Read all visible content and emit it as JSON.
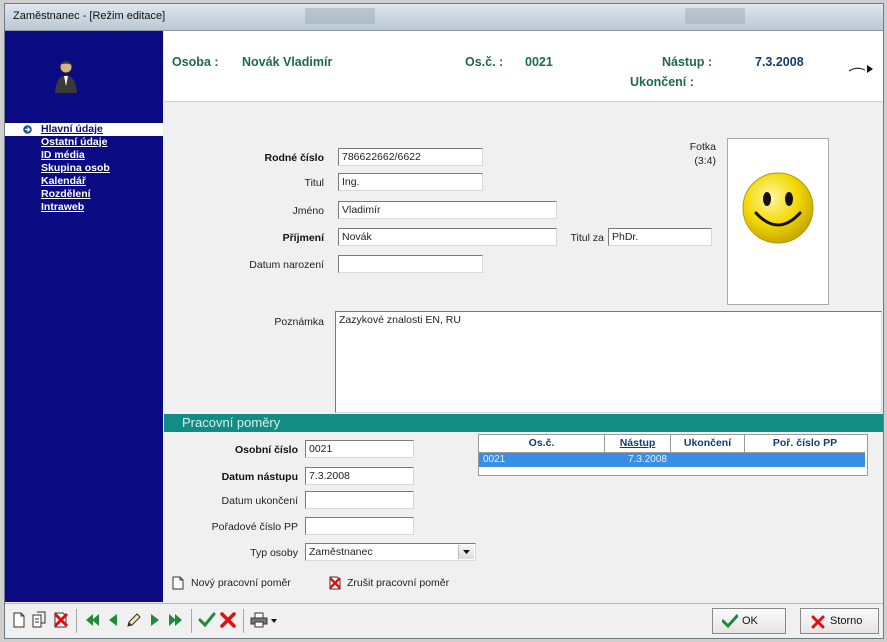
{
  "window": {
    "title": "Zaměstnanec - [Režim editace]"
  },
  "sidebar": {
    "items": [
      {
        "label": "Hlavní údaje",
        "active": true
      },
      {
        "label": "Ostatní údaje"
      },
      {
        "label": "ID média"
      },
      {
        "label": "Skupina osob"
      },
      {
        "label": "Kalendář"
      },
      {
        "label": "Rozdělení"
      },
      {
        "label": "Intraweb"
      }
    ]
  },
  "header": {
    "osoba_label": "Osoba :",
    "osoba_value": "Novák Vladimír",
    "osc_label": "Os.č. :",
    "osc_value": "0021",
    "nastup_label": "Nástup :",
    "nastup_value": "7.3.2008",
    "ukonceni_label": "Ukončení :"
  },
  "form": {
    "rodne_cislo_label": "Rodné číslo",
    "rodne_cislo_value": "786622662/6622",
    "titul_label": "Titul",
    "titul_value": "Ing.",
    "jmeno_label": "Jméno",
    "jmeno_value": "Vladimír",
    "prijmeni_label": "Příjmení",
    "prijmeni_value": "Novák",
    "titul_za_label": "Titul za",
    "titul_za_value": "PhDr.",
    "datum_narozeni_label": "Datum narození",
    "datum_narozeni_value": "",
    "fotka_label": "Fotka",
    "fotka_ratio": "(3:4)",
    "poznamka_label": "Poznámka",
    "poznamka_value": "Zazykové znalosti EN, RU"
  },
  "pracovni": {
    "section_title": "Pracovní poměry",
    "osobni_cislo_label": "Osobní číslo",
    "osobni_cislo_value": "0021",
    "datum_nastupu_label": "Datum nástupu",
    "datum_nastupu_value": "7.3.2008",
    "datum_ukonceni_label": "Datum ukončení",
    "datum_ukonceni_value": "",
    "poradove_cislo_label": "Pořadové číslo PP",
    "poradove_cislo_value": "",
    "typ_osoby_label": "Typ osoby",
    "typ_osoby_value": "Zaměstnanec",
    "table": {
      "headers": [
        "Os.č.",
        "Nástup",
        "Ukončení",
        "Poř. číslo PP"
      ],
      "rows": [
        {
          "osc": "0021",
          "nastup": "7.3.2008",
          "ukonceni": "",
          "poradove": ""
        }
      ]
    },
    "novy_label": "Nový pracovní poměr",
    "zrusit_label": "Zrušit pracovní poměr"
  },
  "buttons": {
    "ok_label": "OK",
    "storno_label": "Storno"
  },
  "colors": {
    "sidebar": "#0a0a82",
    "section": "#128c84",
    "header_text": "#1d6a4a",
    "selection": "#3b8ee5"
  }
}
